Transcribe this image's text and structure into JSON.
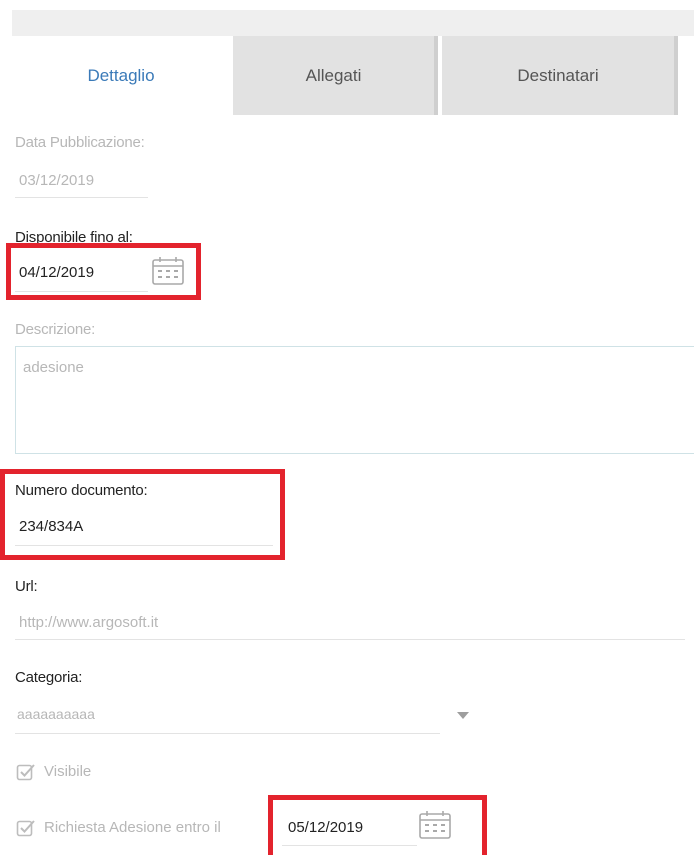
{
  "tabs": [
    {
      "label": "Dettaglio",
      "active": true
    },
    {
      "label": "Allegati",
      "active": false
    },
    {
      "label": "Destinatari",
      "active": false
    }
  ],
  "fields": {
    "data_pubblicazione": {
      "label": "Data Pubblicazione:",
      "value": "03/12/2019"
    },
    "disponibile_fino": {
      "label": "Disponibile fino al:",
      "value": "04/12/2019"
    },
    "descrizione": {
      "label": "Descrizione:",
      "value": "adesione"
    },
    "numero_documento": {
      "label": "Numero documento:",
      "value": "234/834A"
    },
    "url": {
      "label": "Url:",
      "value": "http://www.argosoft.it"
    },
    "categoria": {
      "label": "Categoria:",
      "value": "aaaaaaaaaa"
    }
  },
  "checkboxes": {
    "visibile": {
      "label": "Visibile",
      "checked": true
    },
    "richiesta_adesione": {
      "label": "Richiesta Adesione entro il",
      "checked": true,
      "date": "05/12/2019"
    }
  },
  "colors": {
    "accent": "#3a7ab8",
    "highlight": "#e3232d",
    "disabled": "#b7b7b7"
  }
}
